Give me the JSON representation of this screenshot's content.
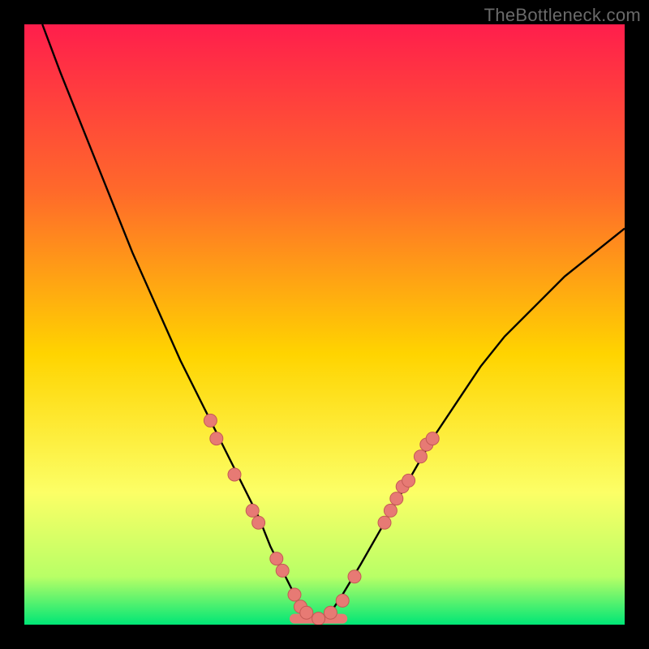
{
  "watermark": "TheBottleneck.com",
  "colors": {
    "gradient_top": "#ff1e4c",
    "gradient_upper_mid": "#ff6a2a",
    "gradient_mid": "#ffd400",
    "gradient_lower_mid": "#fcff66",
    "gradient_near_bottom": "#b8ff66",
    "gradient_bottom": "#00e676",
    "curve": "#000000",
    "marker_fill": "#e77a74",
    "marker_stroke": "#c45a55"
  },
  "chart_data": {
    "type": "line",
    "title": "",
    "xlabel": "",
    "ylabel": "",
    "xlim": [
      0,
      100
    ],
    "ylim": [
      0,
      100
    ],
    "series": [
      {
        "name": "bottleneck-curve",
        "x": [
          3,
          6,
          10,
          14,
          18,
          22,
          26,
          30,
          33,
          36,
          39,
          41,
          43,
          45,
          47,
          49,
          51,
          53,
          56,
          60,
          64,
          68,
          72,
          76,
          80,
          85,
          90,
          95,
          100
        ],
        "y": [
          100,
          92,
          82,
          72,
          62,
          53,
          44,
          36,
          30,
          24,
          18,
          13,
          9,
          5,
          2,
          0,
          2,
          5,
          10,
          17,
          24,
          31,
          37,
          43,
          48,
          53,
          58,
          62,
          66
        ]
      }
    ],
    "markers": [
      {
        "x": 31,
        "y": 34
      },
      {
        "x": 32,
        "y": 31
      },
      {
        "x": 35,
        "y": 25
      },
      {
        "x": 38,
        "y": 19
      },
      {
        "x": 39,
        "y": 17
      },
      {
        "x": 42,
        "y": 11
      },
      {
        "x": 43,
        "y": 9
      },
      {
        "x": 45,
        "y": 5
      },
      {
        "x": 46,
        "y": 3
      },
      {
        "x": 47,
        "y": 2
      },
      {
        "x": 49,
        "y": 1
      },
      {
        "x": 51,
        "y": 2
      },
      {
        "x": 53,
        "y": 4
      },
      {
        "x": 55,
        "y": 8
      },
      {
        "x": 60,
        "y": 17
      },
      {
        "x": 61,
        "y": 19
      },
      {
        "x": 62,
        "y": 21
      },
      {
        "x": 63,
        "y": 23
      },
      {
        "x": 64,
        "y": 24
      },
      {
        "x": 66,
        "y": 28
      },
      {
        "x": 67,
        "y": 30
      },
      {
        "x": 68,
        "y": 31
      }
    ],
    "flat_bottom": {
      "x_start": 45,
      "x_end": 53,
      "y": 1
    }
  }
}
